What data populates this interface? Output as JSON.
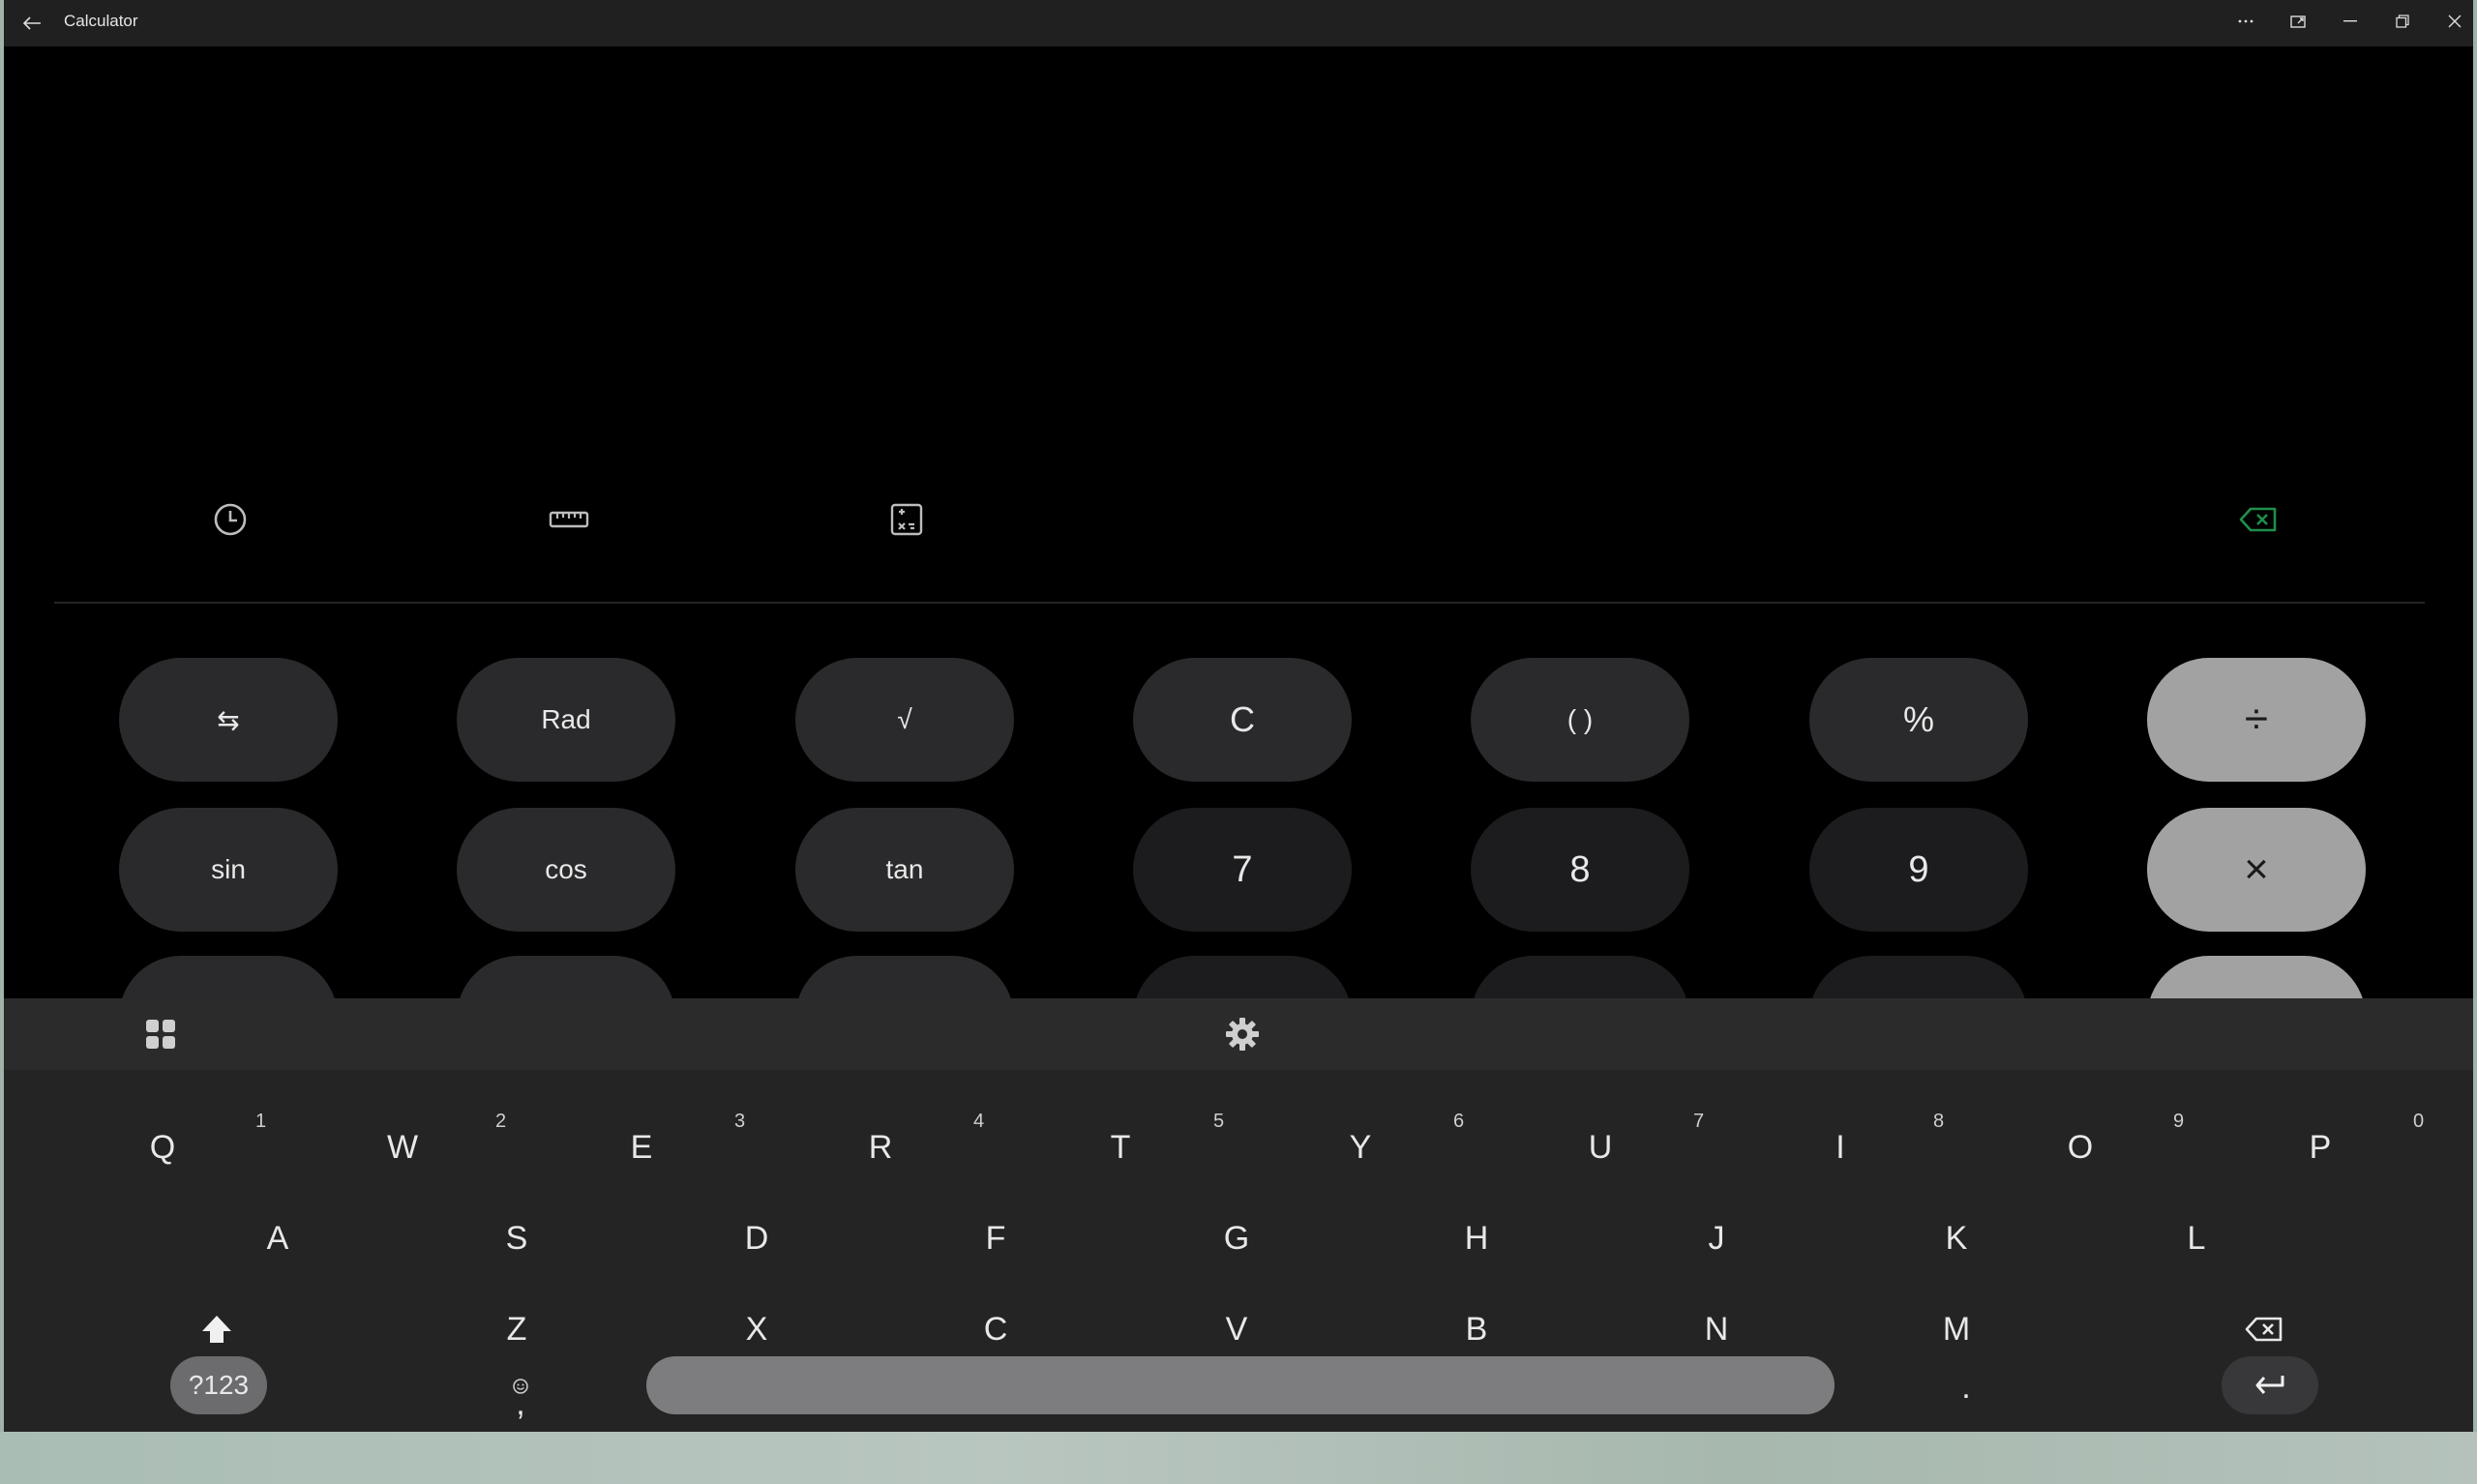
{
  "window": {
    "title": "Calculator"
  },
  "colors": {
    "accent_green": "#1f8f4a",
    "operator_key": "#a2a2a2",
    "function_key": "#2a2a2c",
    "number_key": "#1c1c1e"
  },
  "icons": {
    "back": "back-arrow-icon",
    "more": "more-options-icon",
    "compact": "compact-overlay-icon",
    "minimize": "minimize-icon",
    "restore": "restore-icon",
    "close": "close-icon",
    "history": "history-icon",
    "unit_converter": "ruler-icon",
    "scientific": "calculator-plus-icon",
    "backspace": "backspace-icon",
    "shift": "shift-icon",
    "enter": "enter-icon",
    "emoji": "emoji-icon",
    "apps": "apps-grid-icon",
    "settings": "gear-icon"
  },
  "keypad": {
    "row1": [
      "⇆",
      "Rad",
      "√",
      "C",
      "( )",
      "%",
      "÷"
    ],
    "row2": [
      "sin",
      "cos",
      "tan",
      "7",
      "8",
      "9",
      "×"
    ]
  },
  "keyboard": {
    "row1": [
      {
        "key": "Q",
        "hint": "1"
      },
      {
        "key": "W",
        "hint": "2"
      },
      {
        "key": "E",
        "hint": "3"
      },
      {
        "key": "R",
        "hint": "4"
      },
      {
        "key": "T",
        "hint": "5"
      },
      {
        "key": "Y",
        "hint": "6"
      },
      {
        "key": "U",
        "hint": "7"
      },
      {
        "key": "I",
        "hint": "8"
      },
      {
        "key": "O",
        "hint": "9"
      },
      {
        "key": "P",
        "hint": "0"
      }
    ],
    "row2": [
      "A",
      "S",
      "D",
      "F",
      "G",
      "H",
      "J",
      "K",
      "L"
    ],
    "row3": [
      "Z",
      "X",
      "C",
      "V",
      "B",
      "N",
      "M"
    ],
    "symbols_label": "?123",
    "comma": ",",
    "period": "."
  }
}
